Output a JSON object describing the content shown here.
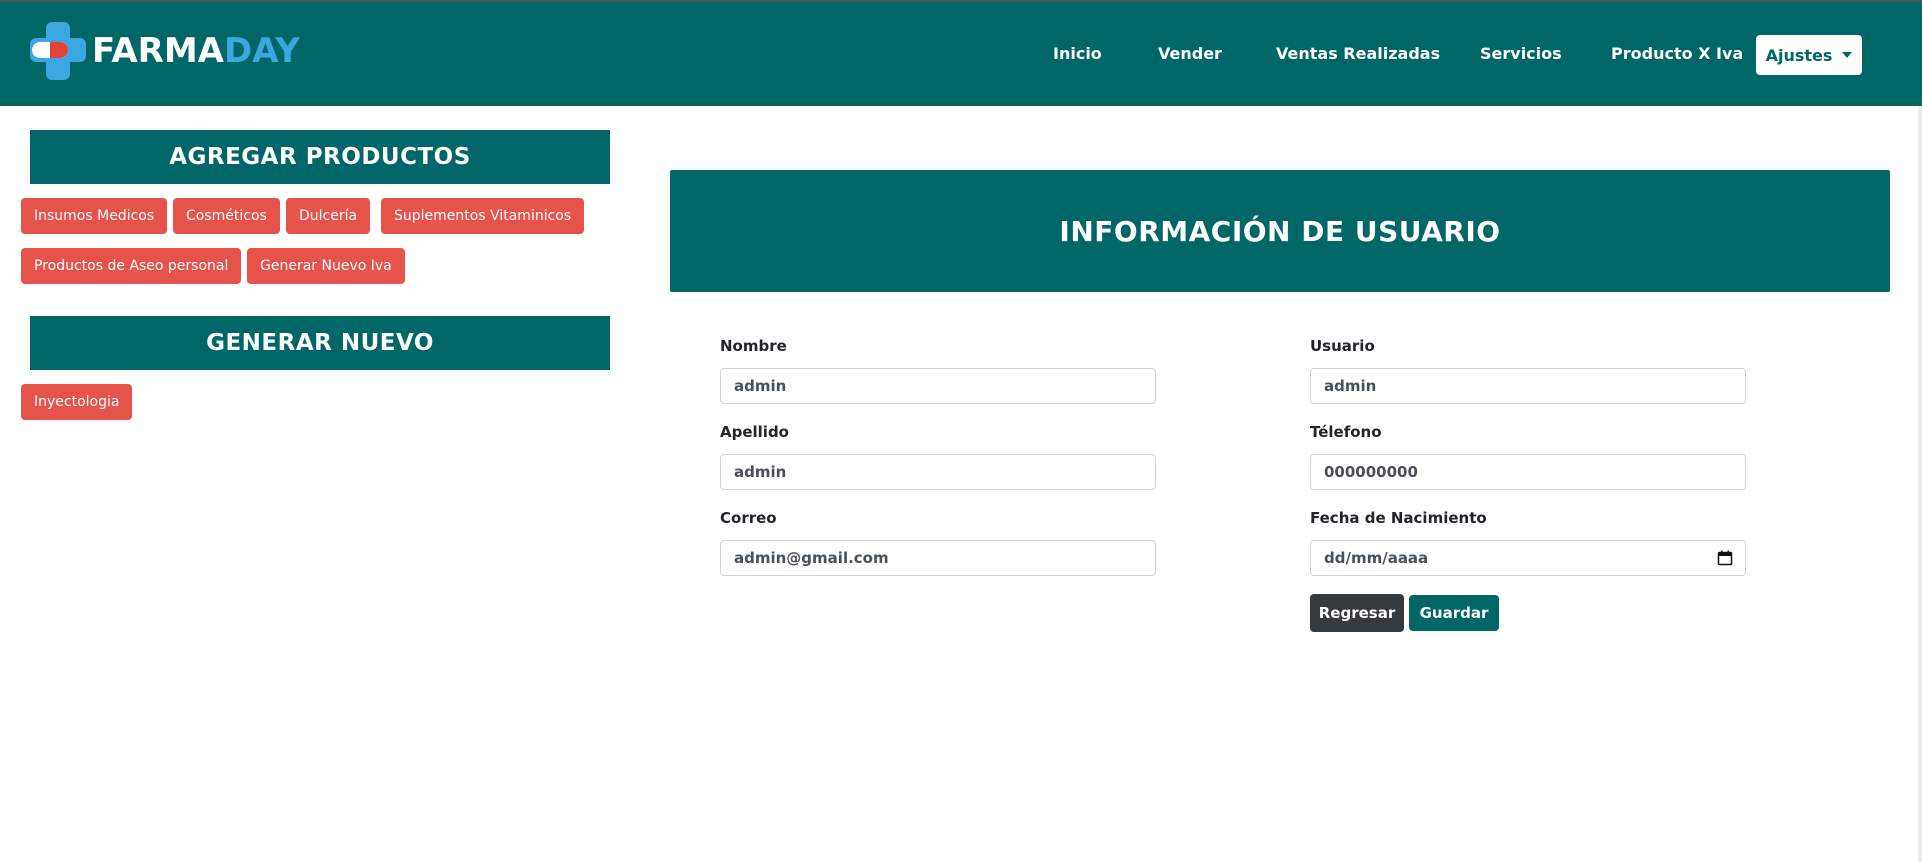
{
  "brand": {
    "part1": "FARMA",
    "part2": "DAY",
    "icon": "pharmacy-cross-pill-icon"
  },
  "nav": {
    "items": [
      "Inicio",
      "Vender",
      "Ventas Realizadas",
      "Servicios",
      "Producto X Iva"
    ],
    "settings_label": "Ajustes"
  },
  "sidebar": {
    "add_products_title": "AGREGAR PRODUCTOS",
    "add_products_buttons": [
      "Insumos Medicos",
      "Cosméticos",
      "Dulcería",
      "Suplementos Vitaminicos",
      "Productos de Aseo personal",
      "Generar Nuevo Iva"
    ],
    "generate_title": "GENERAR NUEVO",
    "generate_buttons": [
      "Inyectologia"
    ]
  },
  "user_info": {
    "title": "INFORMACIÓN DE USUARIO",
    "fields": {
      "nombre": {
        "label": "Nombre",
        "value": "admin"
      },
      "usuario": {
        "label": "Usuario",
        "value": "admin"
      },
      "apellido": {
        "label": "Apellido",
        "value": "admin"
      },
      "telefono": {
        "label": "Télefono",
        "value": "000000000"
      },
      "correo": {
        "label": "Correo",
        "value": "admin@gmail.com"
      },
      "fecha": {
        "label": "Fecha de Nacimiento",
        "placeholder": "dd/mm/aaaa"
      }
    },
    "buttons": {
      "back": "Regresar",
      "save": "Guardar"
    }
  },
  "colors": {
    "primary": "#006666",
    "accent": "#3aa7e0",
    "danger": "#e5534b",
    "dark": "#343a40"
  }
}
